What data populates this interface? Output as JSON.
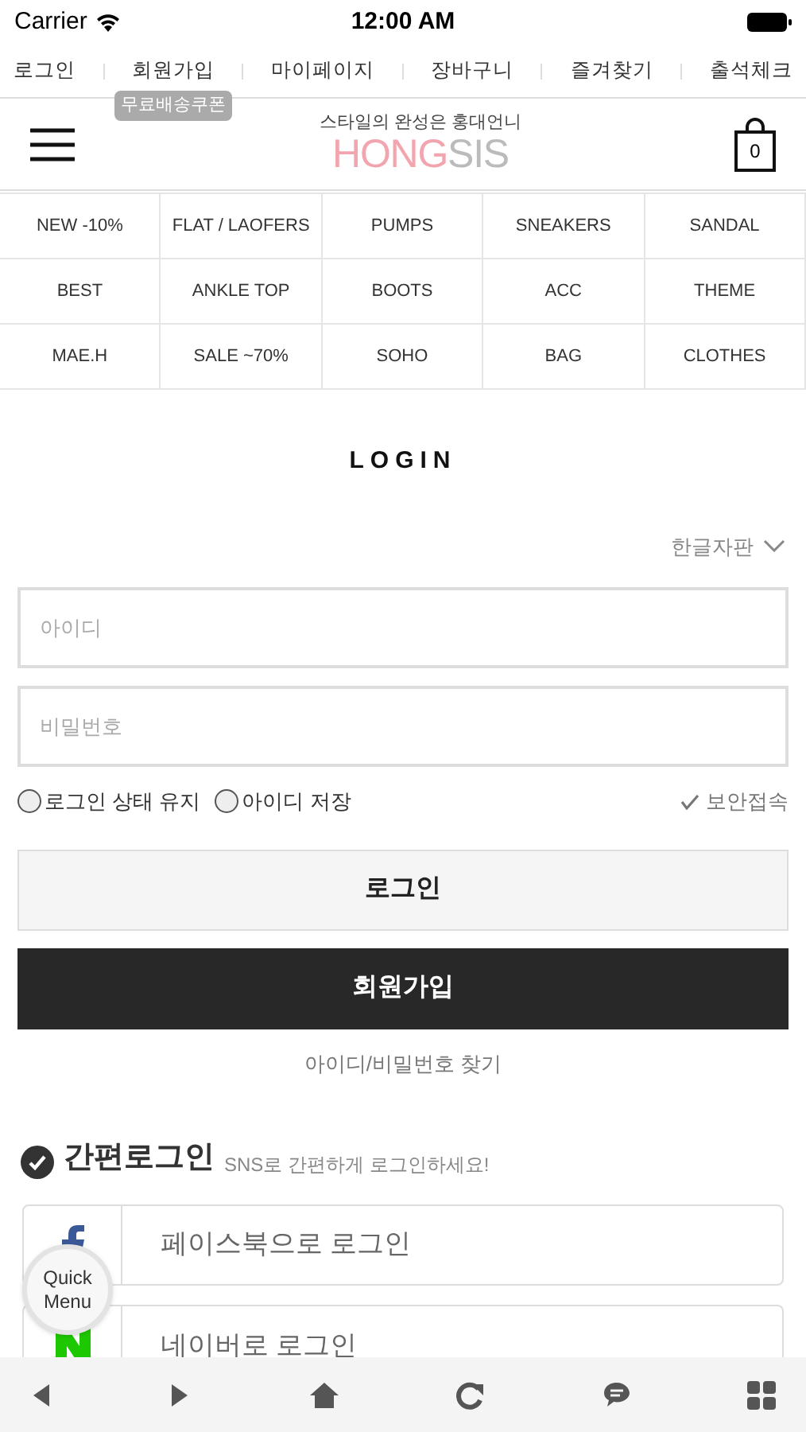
{
  "status_bar": {
    "carrier": "Carrier",
    "time": "12:00 AM"
  },
  "top_links": [
    {
      "label": "로그인"
    },
    {
      "label": "회원가입",
      "badge": "무료배송쿠폰"
    },
    {
      "label": "마이페이지"
    },
    {
      "label": "장바구니"
    },
    {
      "label": "즐겨찾기"
    },
    {
      "label": "출석체크"
    }
  ],
  "header": {
    "tagline": "스타일의 완성은 홍대언니",
    "logo_main": "HONG",
    "logo_accent": "SIS",
    "cart_count": "0"
  },
  "categories": [
    "NEW -10%",
    "FLAT / LAOFERS",
    "PUMPS",
    "SNEAKERS",
    "SANDAL",
    "BEST",
    "ANKLE TOP",
    "BOOTS",
    "ACC",
    "THEME",
    "MAE.H",
    "SALE ~70%",
    "SOHO",
    "BAG",
    "CLOTHES"
  ],
  "login": {
    "title": "LOGIN",
    "keyboard": "한글자판",
    "id_placeholder": "아이디",
    "password_placeholder": "비밀번호",
    "options": [
      {
        "label": "로그인 상태 유지",
        "checked": false
      },
      {
        "label": "아이디 저장",
        "checked": false
      }
    ],
    "secure": "보안접속",
    "login_button": "로그인",
    "signup_button": "회원가입",
    "find_link": "아이디/비밀번호 찾기"
  },
  "easy_login": {
    "title": "간편로그인",
    "subtitle": "SNS로 간편하게 로그인하세요!",
    "providers": [
      {
        "kind": "facebook",
        "label": "페이스북으로 로그인"
      },
      {
        "kind": "naver",
        "label": "네이버로 로그인"
      }
    ]
  },
  "quick_menu": {
    "line1": "Quick",
    "line2": "Menu"
  }
}
